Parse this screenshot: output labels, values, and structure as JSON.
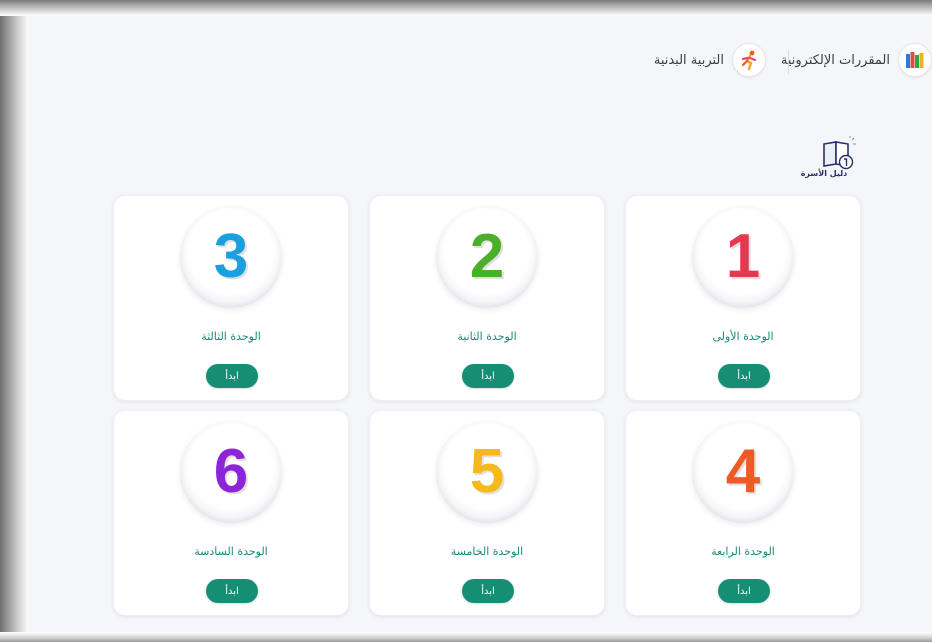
{
  "header": {
    "electronic_courses_label": "المقررات الإلكترونية",
    "physical_education_label": "التربية البدنية"
  },
  "family_guide": {
    "label": "دليل الأسرة"
  },
  "units": [
    {
      "number": "1",
      "title": "الوحدة الأولى",
      "button": "ابدأ",
      "color": "#e53950"
    },
    {
      "number": "2",
      "title": "الوحدة الثانية",
      "button": "ابدأ",
      "color": "#4caf2a"
    },
    {
      "number": "3",
      "title": "الوحدة الثالثة",
      "button": "ابدأ",
      "color": "#1aa0df"
    },
    {
      "number": "4",
      "title": "الوحدة الرابعة",
      "button": "ابدأ",
      "color": "#f05a24"
    },
    {
      "number": "5",
      "title": "الوحدة الخامسة",
      "button": "ابدأ",
      "color": "#f6b91c"
    },
    {
      "number": "6",
      "title": "الوحدة السادسة",
      "button": "ابدأ",
      "color": "#8e24d8"
    }
  ],
  "colors": {
    "accent": "#168e74",
    "title_text": "#178a72",
    "background": "#f4f6f9"
  }
}
